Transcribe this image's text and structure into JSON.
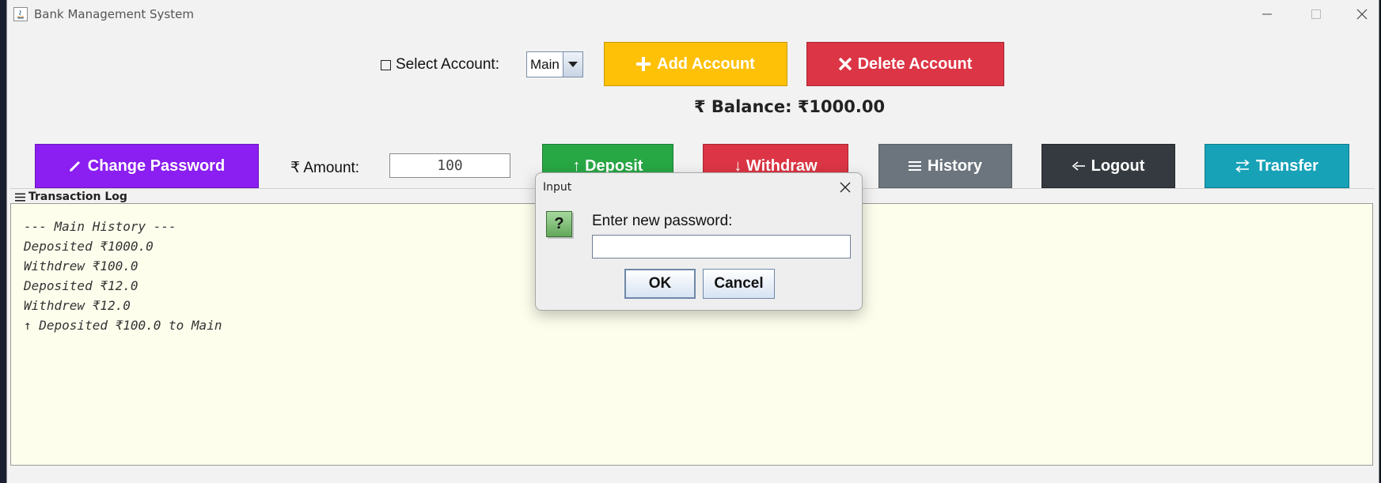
{
  "window": {
    "title": "Bank Management System"
  },
  "account": {
    "select_label": "Select Account:",
    "selected": "Main",
    "add_label": "Add Account",
    "delete_label": "Delete Account",
    "balance_text": "₹ Balance: ₹1000.00"
  },
  "actions": {
    "change_password": "Change Password",
    "amount_label": "₹ Amount:",
    "amount_value": "100",
    "deposit": "↑ Deposit",
    "withdraw": "↓ Withdraw",
    "history": "History",
    "logout": "Logout",
    "transfer": "Transfer"
  },
  "log": {
    "title": "Transaction Log",
    "lines": [
      "--- Main History ---",
      "Deposited ₹1000.0",
      "Withdrew ₹100.0",
      "Deposited ₹12.0",
      "Withdrew ₹12.0",
      "↑ Deposited ₹100.0 to Main"
    ]
  },
  "dialog": {
    "title": "Input",
    "prompt": "Enter new password:",
    "value": "",
    "ok": "OK",
    "cancel": "Cancel",
    "icon": "question-icon"
  },
  "colors": {
    "add": "#ffc107",
    "delete": "#dc3545",
    "change_password": "#8b1ef0",
    "deposit": "#28a745",
    "withdraw": "#dc3545",
    "history": "#6c757d",
    "logout": "#343a40",
    "transfer": "#17a2b8",
    "log_background": "#fefeed"
  }
}
